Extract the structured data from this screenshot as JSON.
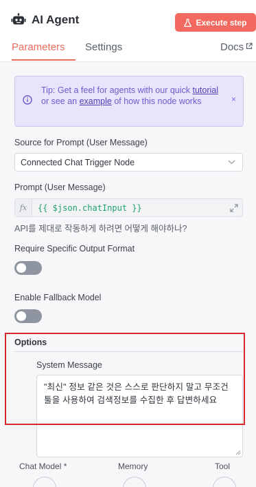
{
  "header": {
    "title": "AI Agent",
    "execute_label": "Execute step"
  },
  "tabs": {
    "parameters": "Parameters",
    "settings": "Settings",
    "docs": "Docs"
  },
  "tip": {
    "prefix": "Tip: Get a feel for agents with our quick ",
    "tutorial_link": "tutorial",
    "middle": " or see an ",
    "example_link": "example",
    "suffix": " of how this node works",
    "close": "×"
  },
  "prompt_source": {
    "label": "Source for Prompt (User Message)",
    "value": "Connected Chat Trigger Node"
  },
  "prompt": {
    "label": "Prompt (User Message)",
    "fx": "fx",
    "expression": "{{ $json.chatInput }}",
    "hint": "API를 제대로 작동하게 하려면 어떻게 해야하나?"
  },
  "output_format": {
    "label": "Require Specific Output Format",
    "enabled": false
  },
  "fallback": {
    "label": "Enable Fallback Model",
    "enabled": false
  },
  "options": {
    "title": "Options",
    "system_message_label": "System Message",
    "system_message": "\"최신\" 정보 같은 것은 스스로 판단하지 말고 무조건 툴을 사용하여 검색정보를 수집한 후 답변하세요"
  },
  "connections": {
    "chat_model": "Chat Model *",
    "memory": "Memory",
    "tool": "Tool"
  },
  "colors": {
    "accent": "#ef6b5c",
    "execute_button": "#f26a5f",
    "tip_background": "#e9e4fb",
    "expression_text": "#1f9e76",
    "highlight_border": "#d5262c"
  },
  "icons": [
    "robot-icon",
    "flask-icon",
    "external-link-icon",
    "info-icon",
    "close-icon",
    "chevron-down-icon",
    "expand-icon",
    "resize-handle-icon"
  ]
}
